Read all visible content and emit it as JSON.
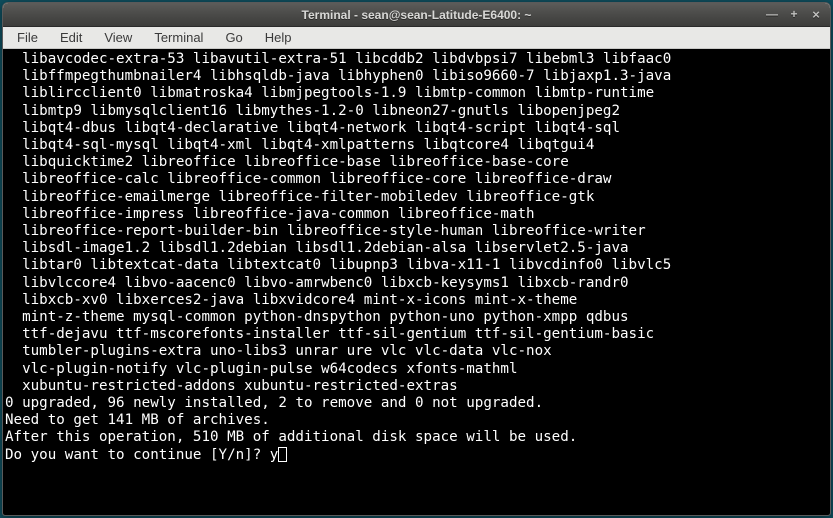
{
  "window": {
    "title": "Terminal - sean@sean-Latitude-E6400: ~"
  },
  "menubar": {
    "items": [
      "File",
      "Edit",
      "View",
      "Terminal",
      "Go",
      "Help"
    ]
  },
  "terminal": {
    "package_lines": [
      "libavcodec-extra-53 libavutil-extra-51 libcddb2 libdvbpsi7 libebml3 libfaac0",
      "libffmpegthumbnailer4 libhsqldb-java libhyphen0 libiso9660-7 libjaxp1.3-java",
      "liblircclient0 libmatroska4 libmjpegtools-1.9 libmtp-common libmtp-runtime",
      "libmtp9 libmysqlclient16 libmythes-1.2-0 libneon27-gnutls libopenjpeg2",
      "libqt4-dbus libqt4-declarative libqt4-network libqt4-script libqt4-sql",
      "libqt4-sql-mysql libqt4-xml libqt4-xmlpatterns libqtcore4 libqtgui4",
      "libquicktime2 libreoffice libreoffice-base libreoffice-base-core",
      "libreoffice-calc libreoffice-common libreoffice-core libreoffice-draw",
      "libreoffice-emailmerge libreoffice-filter-mobiledev libreoffice-gtk",
      "libreoffice-impress libreoffice-java-common libreoffice-math",
      "libreoffice-report-builder-bin libreoffice-style-human libreoffice-writer",
      "libsdl-image1.2 libsdl1.2debian libsdl1.2debian-alsa libservlet2.5-java",
      "libtar0 libtextcat-data libtextcat0 libupnp3 libva-x11-1 libvcdinfo0 libvlc5",
      "libvlccore4 libvo-aacenc0 libvo-amrwbenc0 libxcb-keysyms1 libxcb-randr0",
      "libxcb-xv0 libxerces2-java libxvidcore4 mint-x-icons mint-x-theme",
      "mint-z-theme mysql-common python-dnspython python-uno python-xmpp qdbus",
      "ttf-dejavu ttf-mscorefonts-installer ttf-sil-gentium ttf-sil-gentium-basic",
      "tumbler-plugins-extra uno-libs3 unrar ure vlc vlc-data vlc-nox",
      "vlc-plugin-notify vlc-plugin-pulse w64codecs xfonts-mathml",
      "xubuntu-restricted-addons xubuntu-restricted-extras"
    ],
    "status_lines": [
      "0 upgraded, 96 newly installed, 2 to remove and 0 not upgraded.",
      "Need to get 141 MB of archives.",
      "After this operation, 510 MB of additional disk space will be used."
    ],
    "prompt": "Do you want to continue [Y/n]? ",
    "input": "y"
  }
}
